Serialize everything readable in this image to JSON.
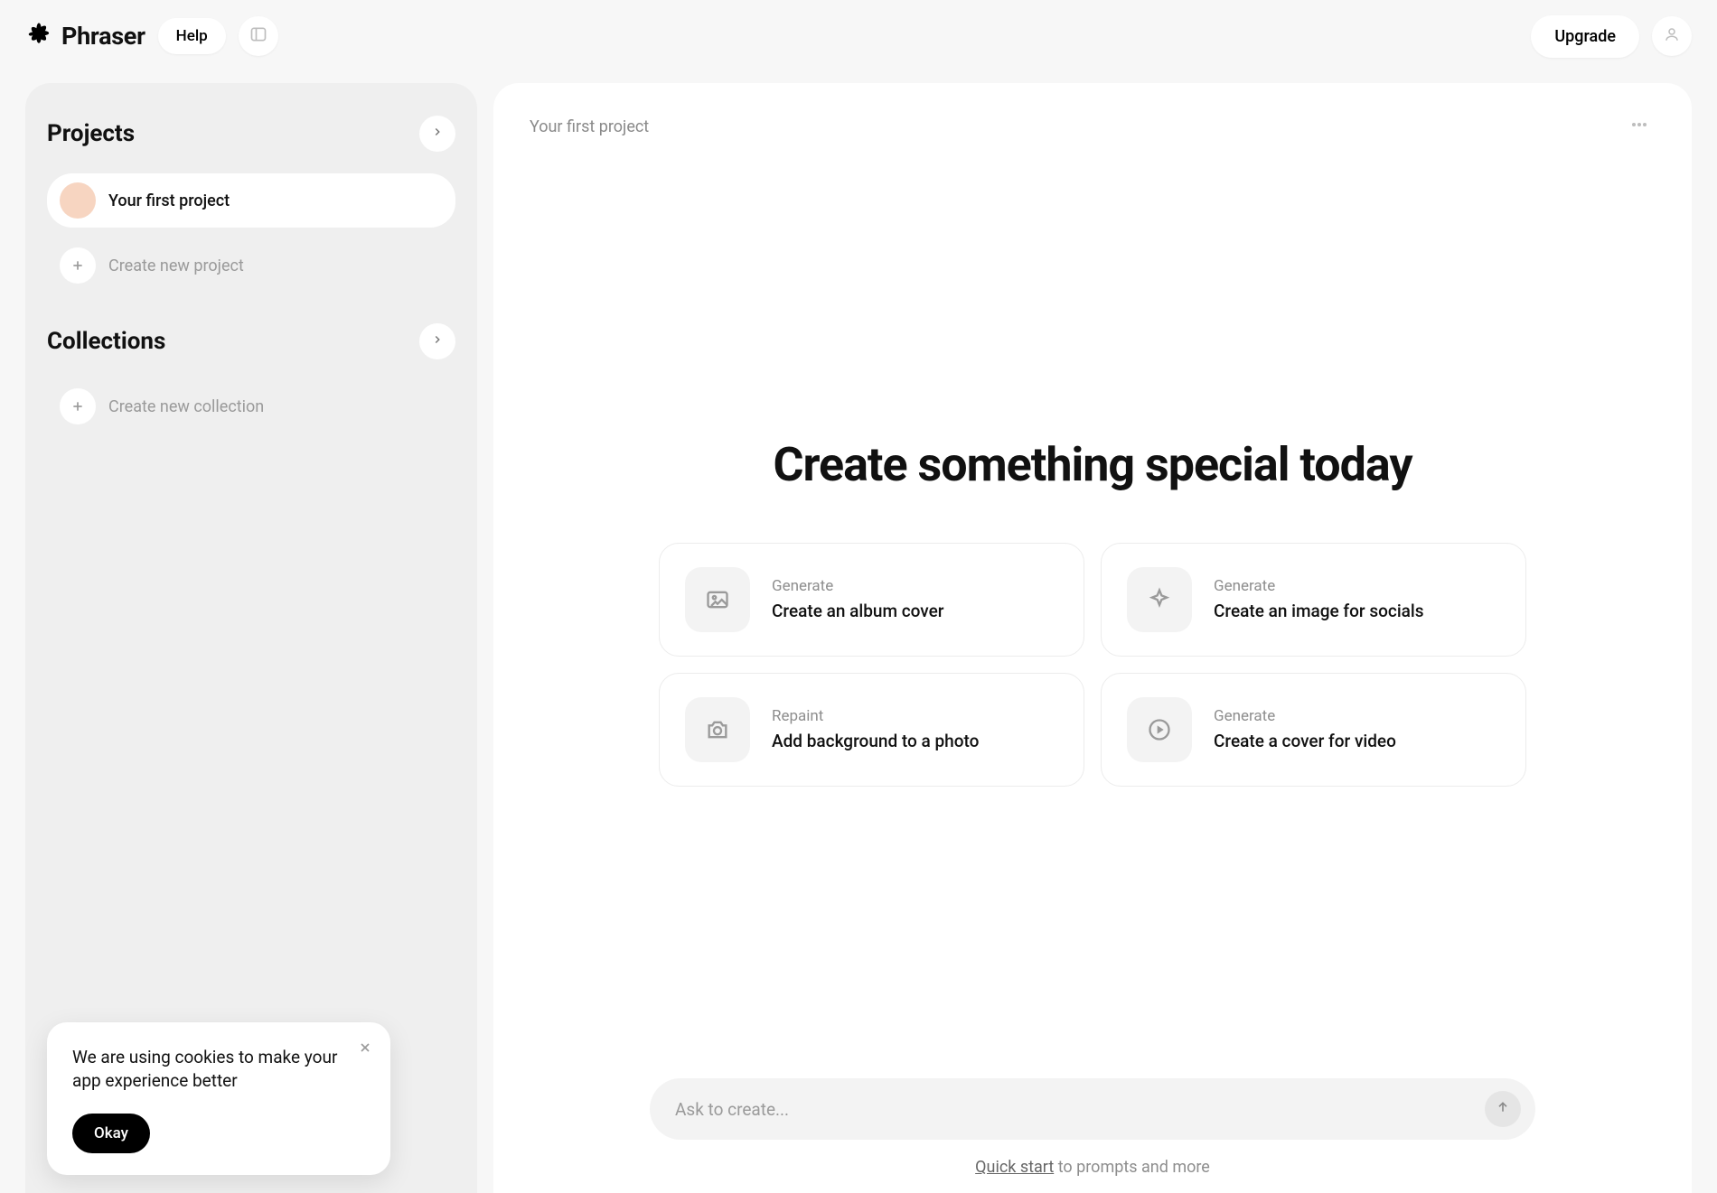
{
  "header": {
    "brand": "Phraser",
    "help": "Help",
    "upgrade": "Upgrade"
  },
  "sidebar": {
    "projects_title": "Projects",
    "project_items": [
      {
        "name": "Your first project"
      }
    ],
    "create_project": "Create new project",
    "collections_title": "Collections",
    "create_collection": "Create new collection"
  },
  "main": {
    "breadcrumb": "Your first project",
    "hero": "Create something special today",
    "cards": [
      {
        "category": "Generate",
        "title": "Create an album cover",
        "icon": "image-icon"
      },
      {
        "category": "Generate",
        "title": "Create an image for socials",
        "icon": "sparkle-icon"
      },
      {
        "category": "Repaint",
        "title": "Add background to a photo",
        "icon": "camera-icon"
      },
      {
        "category": "Generate",
        "title": "Create a cover for video",
        "icon": "play-icon"
      }
    ],
    "ask_placeholder": "Ask to create...",
    "quick_link": "Quick start",
    "quick_rest": " to prompts and more"
  },
  "toast": {
    "message": "We are using cookies to make your app experience better",
    "ok": "Okay"
  }
}
